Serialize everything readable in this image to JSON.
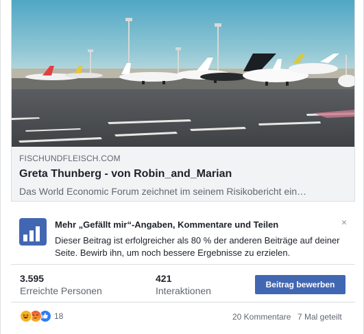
{
  "link": {
    "domain": "FISCHUNDFLEISCH.COM",
    "title": "Greta Thunberg - von Robin_and_Marian",
    "description": "Das World Economic Forum zeichnet im seinem Risikobericht ein…"
  },
  "promo": {
    "title": "Mehr „Gefällt mir“-Angaben, Kommentare und Teilen",
    "body": "Dieser Beitrag ist erfolgreicher als 80 % der anderen Beiträge auf deiner Seite. Bewirb ihn, um noch bessere Ergebnisse zu erzielen.",
    "close_symbol": "×",
    "icon": "chart-growth-icon"
  },
  "stats": {
    "reached_value": "3.595",
    "reached_label": "Erreichte Personen",
    "interactions_value": "421",
    "interactions_label": "Interaktionen",
    "boost_label": "Beitrag bewerben"
  },
  "footer": {
    "reaction_icons": [
      "haha-icon",
      "angry-icon",
      "like-icon"
    ],
    "reaction_count": "18",
    "comments": "20 Kommentare",
    "shares": "7 Mal geteilt"
  },
  "colors": {
    "button": "#4267b2",
    "text_secondary": "#606770",
    "divider": "#dadde1"
  }
}
